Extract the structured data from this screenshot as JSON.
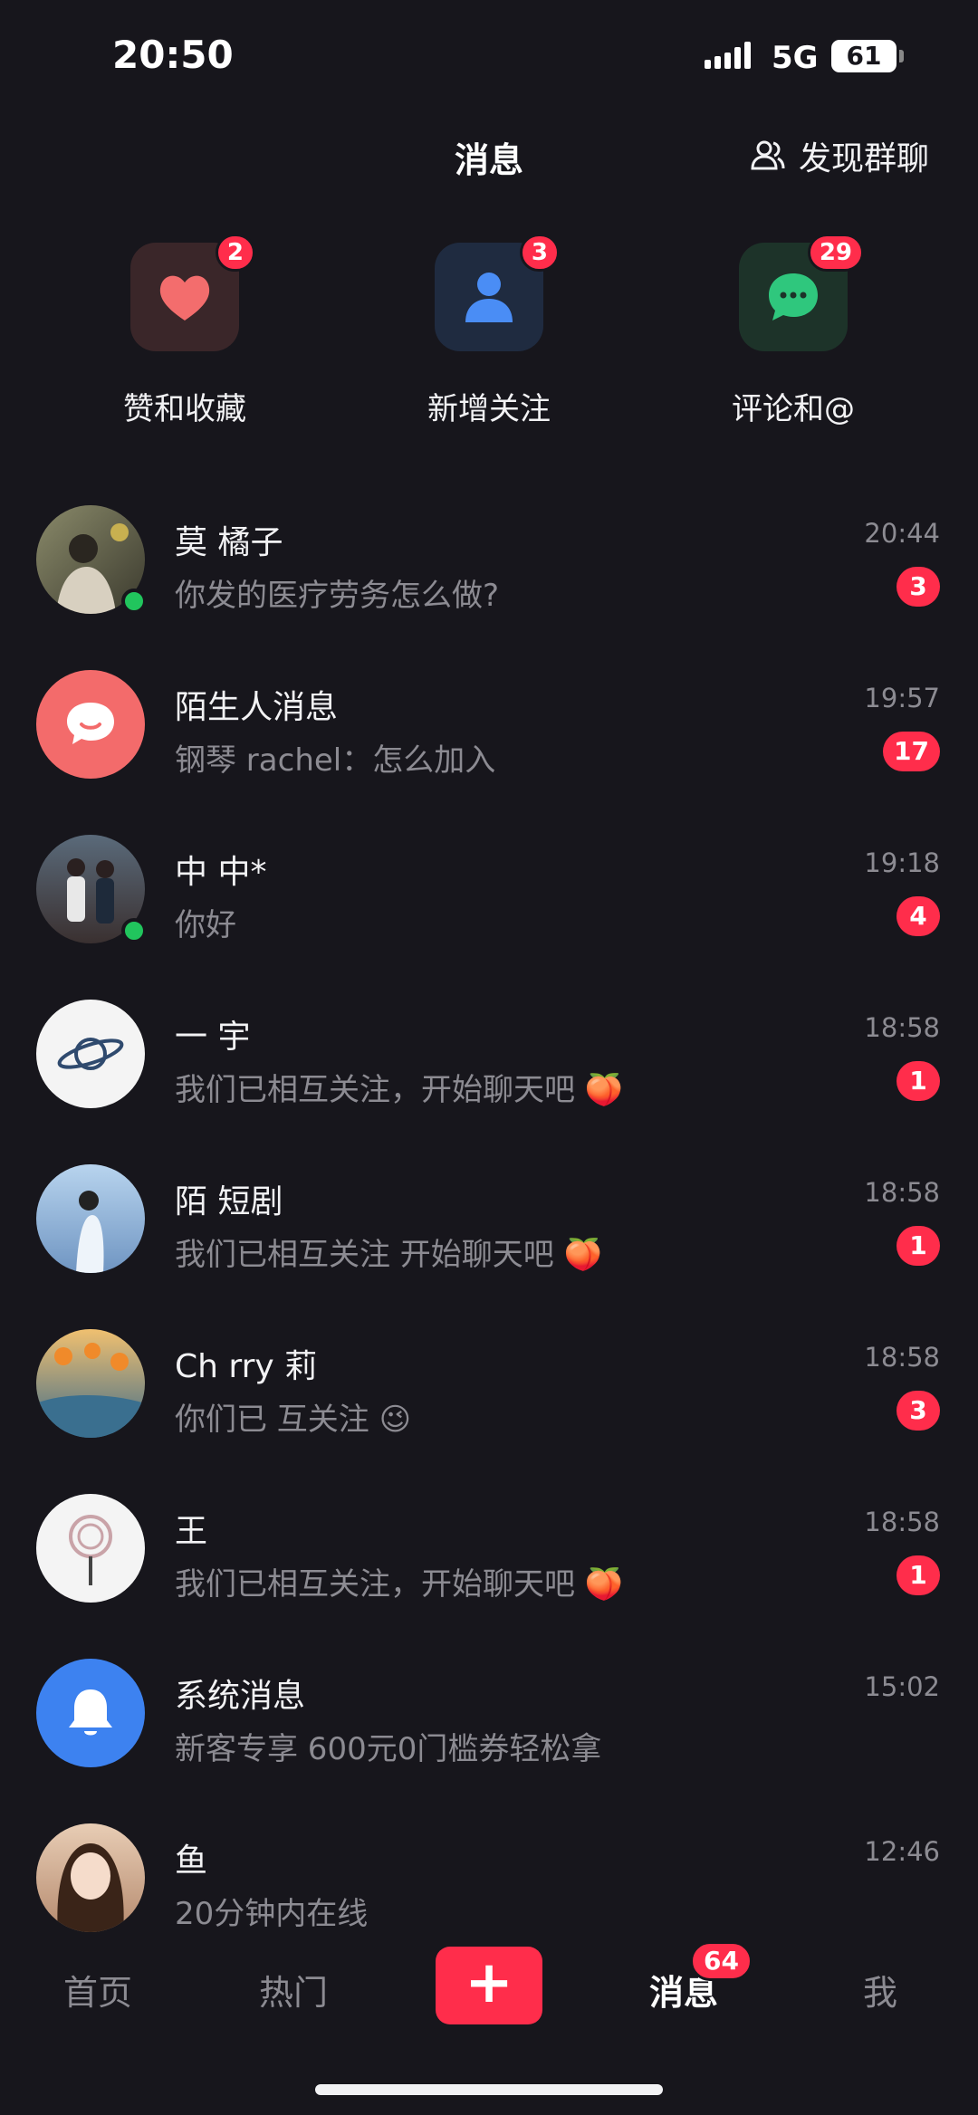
{
  "status_bar": {
    "time": "20:50",
    "network": "5G",
    "battery": "61"
  },
  "header": {
    "title": "消息",
    "discover_group_label": "发现群聊"
  },
  "quick_actions": [
    {
      "label": "赞和收藏",
      "badge": "2",
      "icon": "heart-icon",
      "color": "#f36d6d",
      "tile_bg": "#3a2629"
    },
    {
      "label": "新增关注",
      "badge": "3",
      "icon": "person-icon",
      "color": "#4a8df5",
      "tile_bg": "#1f2b40"
    },
    {
      "label": "评论和@",
      "badge": "29",
      "icon": "chat-bubble-icon",
      "color": "#2fc77d",
      "tile_bg": "#1d3329"
    }
  ],
  "chats": [
    {
      "name": "莫 橘子",
      "preview": "你发的医疗劳务怎么做?",
      "time": "20:44",
      "badge": "3",
      "online": true,
      "avatar": "photo-avatar",
      "avatar_color": "#6b6a52"
    },
    {
      "name": "陌生人消息",
      "preview": "钢琴 rachel：怎么加入",
      "time": "19:57",
      "badge": "17",
      "online": false,
      "avatar": "stranger-message-icon",
      "avatar_color": "#f36b6b"
    },
    {
      "name": "中 中*",
      "preview": "你好",
      "time": "19:18",
      "badge": "4",
      "online": true,
      "avatar": "photo-avatar",
      "avatar_color": "#4f5a66"
    },
    {
      "name": "一 宇",
      "preview": "我们已相互关注，开始聊天吧",
      "time": "18:58",
      "badge": "1",
      "online": false,
      "avatar": "planet-avatar",
      "avatar_color": "#f4f4f4"
    },
    {
      "name": "陌 短剧",
      "preview": "我们已相互关注 开始聊天吧",
      "time": "18:58",
      "badge": "1",
      "online": false,
      "avatar": "photo-avatar",
      "avatar_color": "#8fb3d6"
    },
    {
      "name": "Ch rry 莉",
      "preview": "你们已 互关注",
      "time": "18:58",
      "badge": "3",
      "online": false,
      "avatar": "photo-avatar",
      "avatar_color": "#c98b3f"
    },
    {
      "name": "王",
      "preview": "我们已相互关注，开始聊天吧",
      "time": "18:58",
      "badge": "1",
      "online": false,
      "avatar": "lollipop-avatar",
      "avatar_color": "#f4f4f4"
    },
    {
      "name": "系统消息",
      "preview": "新客专享 600元0门槛券轻松拿",
      "time": "15:02",
      "badge": "",
      "online": false,
      "avatar": "bell-icon",
      "avatar_color": "#3d82f0"
    },
    {
      "name": "鱼",
      "preview": "20分钟内在线",
      "time": "12:46",
      "badge": "",
      "online": false,
      "avatar": "photo-avatar",
      "avatar_color": "#d9b8a0"
    }
  ],
  "bottom_nav": {
    "home": "首页",
    "hot": "热门",
    "publish": "+",
    "messages": "消息",
    "messages_badge": "64",
    "me": "我"
  }
}
